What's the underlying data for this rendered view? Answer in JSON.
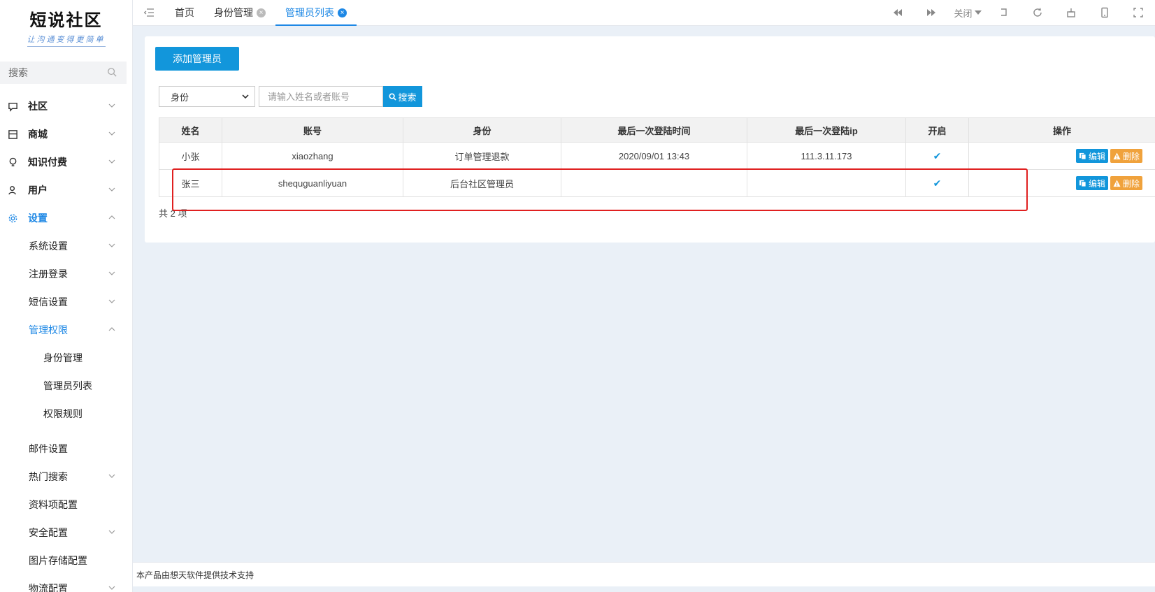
{
  "logo": {
    "title": "短说社区",
    "slogan": "让沟通变得更简单"
  },
  "sidebar": {
    "search": {
      "label": "搜索"
    },
    "menu": [
      {
        "label": "社区",
        "icon": "chat-icon"
      },
      {
        "label": "商城",
        "icon": "store-icon"
      },
      {
        "label": "知识付费",
        "icon": "lightbulb-icon"
      },
      {
        "label": "用户",
        "icon": "user-icon"
      },
      {
        "label": "设置",
        "icon": "gear-icon"
      }
    ],
    "settings_sub": [
      "系统设置",
      "注册登录",
      "短信设置",
      "管理权限",
      "身份管理",
      "管理员列表",
      "权限规则",
      "邮件设置",
      "热门搜索",
      "资料项配置",
      "安全配置",
      "图片存储配置",
      "物流配置"
    ]
  },
  "topbar": {
    "tabs": [
      {
        "label": "首页"
      },
      {
        "label": "身份管理"
      },
      {
        "label": "管理员列表"
      }
    ],
    "close_menu": "关闭"
  },
  "main": {
    "add_button": "添加管理员",
    "filter": {
      "select_value": "身份",
      "keyword_placeholder": "请输入姓名或者账号",
      "search_button": "搜索"
    },
    "table": {
      "headers": [
        "姓名",
        "账号",
        "身份",
        "最后一次登陆时间",
        "最后一次登陆ip",
        "开启",
        "操作"
      ],
      "rows": [
        {
          "name": "小张",
          "account": "xiaozhang",
          "role": "订单管理退款",
          "last_login_time": "2020/09/01 13:43",
          "last_login_ip": "111.3.11.173",
          "enabled": "✔"
        },
        {
          "name": "张三",
          "account": "shequguanliyuan",
          "role": "后台社区管理员",
          "last_login_time": "",
          "last_login_ip": "",
          "enabled": "✔"
        }
      ],
      "edit_label": "编辑",
      "delete_label": "删除"
    },
    "total": "共 2 项"
  },
  "footer": {
    "text": "本产品由想天软件提供技术支持"
  },
  "colors": {
    "accent": "#1296db",
    "warning": "#f0a23c",
    "highlight": "#e02020"
  }
}
